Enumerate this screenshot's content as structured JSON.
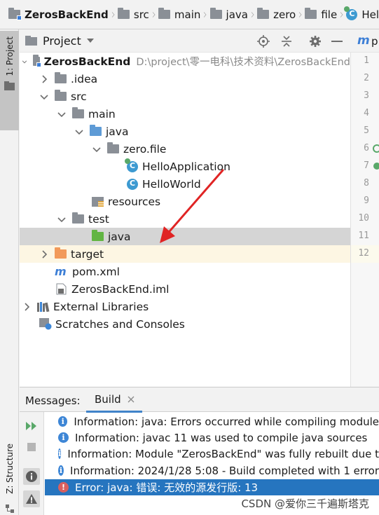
{
  "breadcrumb": [
    {
      "label": "ZerosBackEnd"
    },
    {
      "label": "src"
    },
    {
      "label": "main"
    },
    {
      "label": "java"
    },
    {
      "label": "zero"
    },
    {
      "label": "file"
    },
    {
      "label": "Hel"
    }
  ],
  "left_stripe": {
    "project_tab": "1: Project",
    "structure_tab": "Z: Structure"
  },
  "project_panel": {
    "title": "Project",
    "tree": [
      {
        "label": "ZerosBackEnd",
        "path": "D:\\project\\零一电科\\技术资料\\ZerosBackEnd"
      },
      {
        "label": ".idea"
      },
      {
        "label": "src"
      },
      {
        "label": "main"
      },
      {
        "label": "java"
      },
      {
        "label": "zero.file"
      },
      {
        "label": "HelloApplication"
      },
      {
        "label": "HelloWorld"
      },
      {
        "label": "resources"
      },
      {
        "label": "test"
      },
      {
        "label": "java"
      },
      {
        "label": "target"
      },
      {
        "label": "pom.xml"
      },
      {
        "label": "ZerosBackEnd.iml"
      },
      {
        "label": "External Libraries"
      },
      {
        "label": "Scratches and Consoles"
      }
    ]
  },
  "editor": {
    "tab_label": "p",
    "line_numbers": [
      "1",
      "2",
      "3",
      "4",
      "5",
      "6",
      "7",
      "8",
      "9",
      "10",
      "11",
      "12"
    ]
  },
  "messages": {
    "label": "Messages:",
    "tab": "Build",
    "rows": [
      {
        "type": "info",
        "text": "Information: java: Errors occurred while compiling module"
      },
      {
        "type": "info",
        "text": "Information: javac 11 was used to compile java sources"
      },
      {
        "type": "info",
        "text": "Information: Module \"ZerosBackEnd\" was fully rebuilt due t"
      },
      {
        "type": "info",
        "text": "Information: 2024/1/28 5:08 - Build completed with 1 error"
      },
      {
        "type": "error",
        "text": "Error: java: 错误: 无效的源发行版: 13"
      }
    ]
  },
  "watermark": "CSDN @爱你三千遍斯塔克",
  "colors": {
    "selection": "#d5d5d5",
    "error_row": "#2675bf",
    "annotation_arrow": "#e02424"
  }
}
